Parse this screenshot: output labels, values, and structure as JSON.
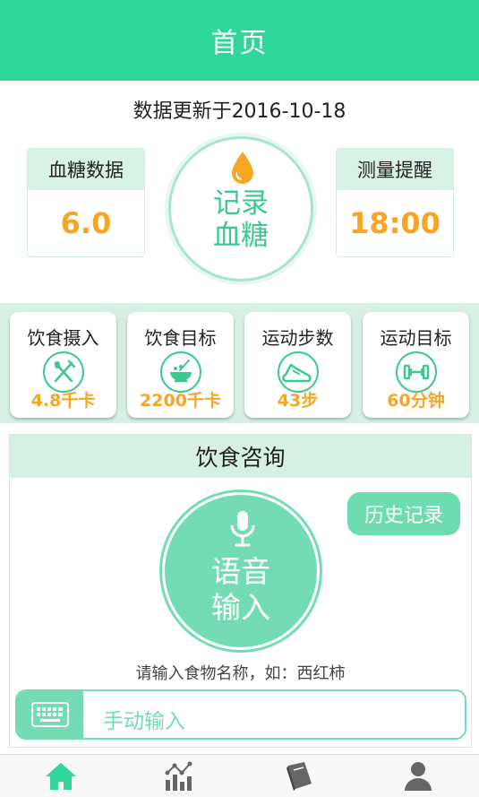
{
  "header": {
    "title": "首页"
  },
  "update": {
    "text": "数据更新于2016-10-18"
  },
  "cards": {
    "glucose": {
      "label": "血糖数据",
      "value": "6.0"
    },
    "reminder": {
      "label": "测量提醒",
      "value": "18:00"
    }
  },
  "record_button": {
    "line1": "记录",
    "line2": "血糖",
    "icon": "drop-icon"
  },
  "tiles": [
    {
      "label": "饮食摄入",
      "value": "4.8千卡",
      "icon": "fork-knife-icon"
    },
    {
      "label": "饮食目标",
      "value": "2200千卡",
      "icon": "bowl-icon"
    },
    {
      "label": "运动步数",
      "value": "43步",
      "icon": "shoe-icon"
    },
    {
      "label": "运动目标",
      "value": "60分钟",
      "icon": "dumbbell-icon"
    }
  ],
  "consult": {
    "title": "饮食咨询",
    "history_label": "历史记录",
    "voice_line1": "语音",
    "voice_line2": "输入",
    "hint": "请输入食物名称，如：西红柿",
    "manual_placeholder": "手动输入"
  },
  "nav": {
    "items": [
      "home-icon",
      "chart-icon",
      "book-icon",
      "user-icon"
    ],
    "active": "home-icon"
  },
  "colors": {
    "brand": "#2fd79b",
    "accent": "#74dcb2",
    "value": "#f6a623",
    "light": "#d6f1e4"
  }
}
